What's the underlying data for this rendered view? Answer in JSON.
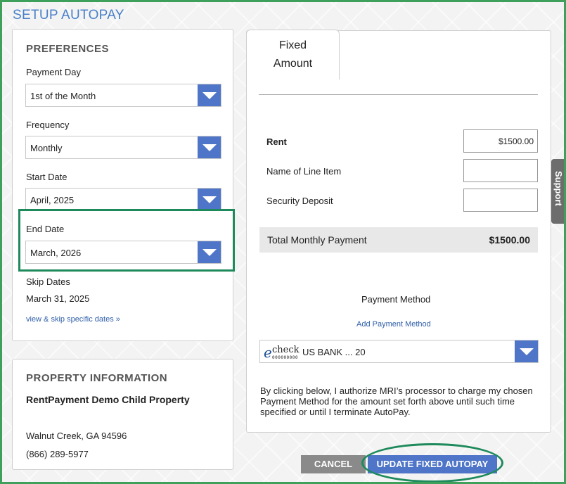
{
  "page": {
    "title": "SETUP AUTOPAY"
  },
  "preferences": {
    "heading": "PREFERENCES",
    "payment_day": {
      "label": "Payment Day",
      "value": "1st of the Month"
    },
    "frequency": {
      "label": "Frequency",
      "value": "Monthly"
    },
    "start_date": {
      "label": "Start Date",
      "value": "April, 2025"
    },
    "end_date": {
      "label": "End Date",
      "value": "March, 2026"
    },
    "skip_dates": {
      "label": "Skip Dates",
      "value": "March 31, 2025",
      "link": "view & skip specific dates »"
    }
  },
  "property": {
    "heading": "PROPERTY INFORMATION",
    "name": "RentPayment Demo Child Property",
    "city": "Walnut Creek, GA 94596",
    "phone": "(866) 289-5977"
  },
  "fixed": {
    "tab_label_1": "Fixed",
    "tab_label_2": "Amount",
    "items": {
      "rent": {
        "label": "Rent",
        "value": "$1500.00"
      },
      "line_item": {
        "label": "Name of Line Item",
        "value": ""
      },
      "security": {
        "label": "Security Deposit",
        "value": ""
      }
    },
    "total": {
      "label": "Total Monthly Payment",
      "value": "$1500.00"
    },
    "payment_method": {
      "label": "Payment Method",
      "add_link": "Add Payment Method",
      "logo_e": "e",
      "logo_check": "check",
      "logo_digits": "000000000",
      "selected": "US BANK ... 20"
    },
    "authorization": "By clicking below, I authorize MRI’s processor to charge my chosen Payment Method for the amount set forth above until such time specified or until I terminate AutoPay."
  },
  "actions": {
    "cancel": "CANCEL",
    "update": "UPDATE FIXED AUTOPAY"
  },
  "support": {
    "label": "Support"
  },
  "colors": {
    "accent": "#4f75c9",
    "title": "#4a7fc9",
    "highlight": "#1e8a5c",
    "frame": "#3ea05a"
  }
}
